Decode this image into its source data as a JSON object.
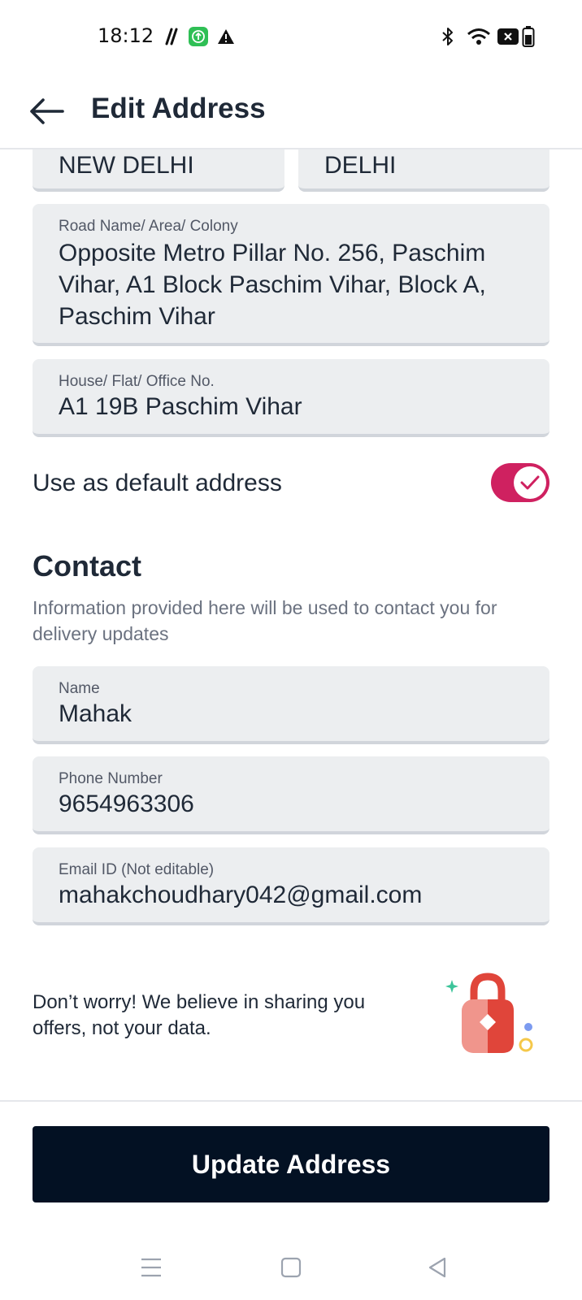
{
  "status_bar": {
    "time": "18:12",
    "icons": [
      "n-fc-icon",
      "upload-app-icon",
      "warning-icon",
      "bluetooth-icon",
      "wifi-icon",
      "no-sim-icon",
      "battery-icon"
    ]
  },
  "header": {
    "title": "Edit Address"
  },
  "address": {
    "city": "NEW DELHI",
    "state": "DELHI",
    "road_label": "Road Name/ Area/ Colony",
    "road_value": "Opposite Metro Pillar No. 256, Paschim Vihar, A1 Block Paschim Vihar, Block A, Paschim Vihar",
    "house_label": "House/ Flat/ Office No.",
    "house_value": "A1 19B Paschim Vihar",
    "default_label": "Use as default address",
    "default_enabled": true
  },
  "contact": {
    "title": "Contact",
    "description": "Information provided here will be used to contact you for delivery updates",
    "name_label": "Name",
    "name_value": "Mahak",
    "phone_label": "Phone Number",
    "phone_value": "9654963306",
    "email_label": "Email ID (Not editable)",
    "email_value": "mahakchoudhary042@gmail.com"
  },
  "privacy": {
    "text": "Don’t worry! We believe in sharing you offers, not your data."
  },
  "actions": {
    "update_label": "Update Address"
  },
  "colors": {
    "accent": "#cf2160",
    "button": "#031123",
    "field_bg": "#eceef0"
  }
}
